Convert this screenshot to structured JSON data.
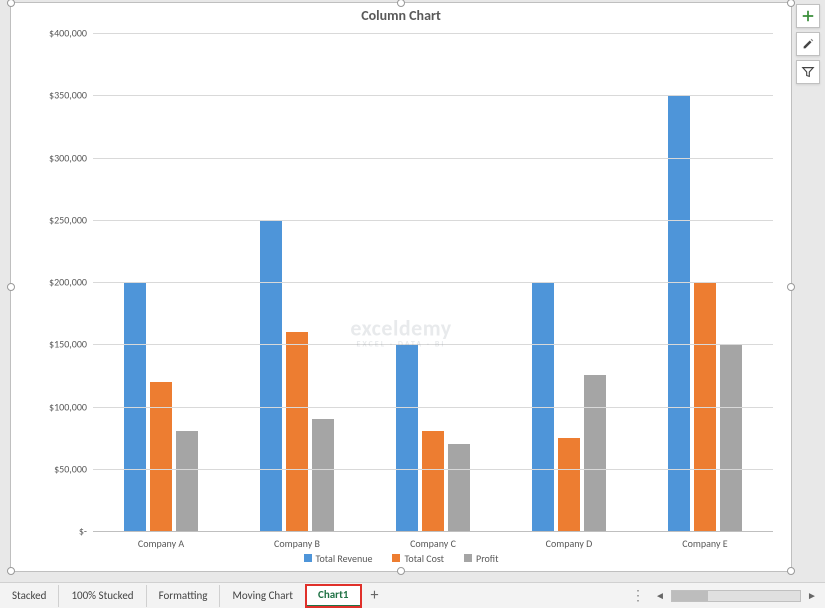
{
  "chart_data": {
    "type": "bar",
    "title": "Column Chart",
    "categories": [
      "Company A",
      "Company B",
      "Company C",
      "Company D",
      "Company E"
    ],
    "series": [
      {
        "name": "Total Revenue",
        "color": "#4e95d9",
        "values": [
          200000,
          250000,
          150000,
          200000,
          350000
        ]
      },
      {
        "name": "Total Cost",
        "color": "#ed7d31",
        "values": [
          120000,
          160000,
          80000,
          75000,
          200000
        ]
      },
      {
        "name": "Profit",
        "color": "#a5a5a5",
        "values": [
          80000,
          90000,
          70000,
          125000,
          150000
        ]
      }
    ],
    "ylim": [
      0,
      400000
    ],
    "y_tick_interval": 50000,
    "y_ticks": [
      "$-",
      "$50,000",
      "$100,000",
      "$150,000",
      "$200,000",
      "$250,000",
      "$300,000",
      "$350,000",
      "$400,000"
    ],
    "xlabel": "",
    "ylabel": ""
  },
  "sheet_tabs": {
    "items": [
      {
        "label": "Stacked"
      },
      {
        "label": "100% Stucked"
      },
      {
        "label": "Formatting"
      },
      {
        "label": "Moving Chart"
      },
      {
        "label": "Chart1",
        "active": true
      }
    ]
  },
  "watermark": {
    "main": "exceldemy",
    "sub": "EXCEL · DATA · BI"
  }
}
